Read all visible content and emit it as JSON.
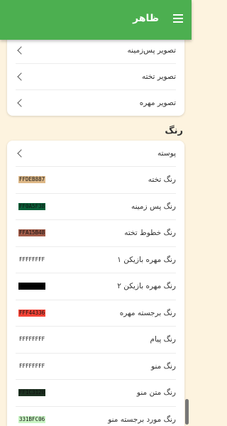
{
  "appbar": {
    "title": "ظاهر",
    "menu_icon": "hamburger-menu-icon"
  },
  "images_card": {
    "items": [
      {
        "label": "تصویر پس‌زمینه"
      },
      {
        "label": "تصویر تخته"
      },
      {
        "label": "تصویر مهره"
      }
    ]
  },
  "color_section": {
    "title": "رنگ",
    "skin_item": {
      "label": "پوسته"
    },
    "colors": [
      {
        "label": "رنگ تخته",
        "value": "FFDEB887",
        "bg": "#deb887",
        "fg": "#111111"
      },
      {
        "label": "رنگ پس زمینه",
        "value": "FF0A5F38",
        "bg": "#0a5f38",
        "fg": "#111111"
      },
      {
        "label": "رنگ خطوط تخته",
        "value": "FFA15B48",
        "bg": "#a15b48",
        "fg": "#111111"
      },
      {
        "label": "رنگ مهره بازیکن ۱",
        "value": "FFFFFFFF",
        "bg": "#ffffff",
        "fg": "#111111"
      },
      {
        "label": "رنگ مهره بازیکن ۲",
        "value": "",
        "bg": "#000000",
        "fg": "#000000"
      },
      {
        "label": "رنگ برجسته مهره",
        "value": "FFF44336",
        "bg": "#f44336",
        "fg": "#111111"
      },
      {
        "label": "رنگ پیام",
        "value": "FFFFFFFF",
        "bg": "#ffffff",
        "fg": "#111111"
      },
      {
        "label": "رنگ منو",
        "value": "FFFFFFFF",
        "bg": "#ffffff",
        "fg": "#111111"
      },
      {
        "label": "رنگ متن منو",
        "value": "FF1C3120",
        "bg": "#1c3120",
        "fg": "#111111"
      },
      {
        "label": "رنگ مورد برجسته منو",
        "value": "331BFC06",
        "bg": "#c9f5c4",
        "fg": "#111111"
      }
    ]
  }
}
